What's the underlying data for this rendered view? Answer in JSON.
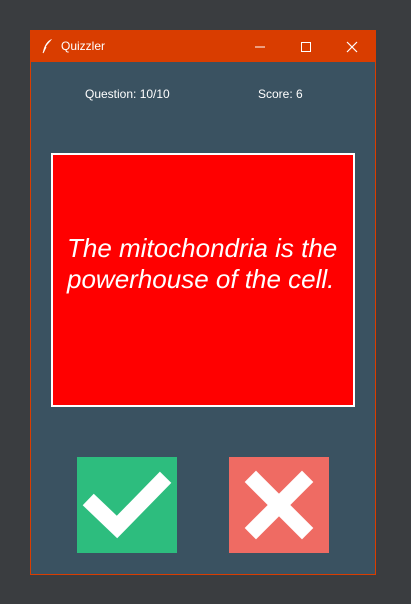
{
  "window": {
    "title": "Quizzler",
    "accent_color": "#d93d00",
    "background_color": "#3a5261",
    "controls": {
      "minimize_icon": "minimize-icon",
      "maximize_icon": "maximize-icon",
      "close_icon": "close-icon"
    }
  },
  "status": {
    "question": "Question: 10/10",
    "score": "Score: 6"
  },
  "card": {
    "text": "The mitochondria is the powerhouse of the cell.",
    "background_color": "#ff0000"
  },
  "buttons": {
    "true_icon": "checkmark-icon",
    "false_icon": "cross-icon",
    "true_color": "#2dbd7e",
    "false_color": "#ef6b63"
  }
}
